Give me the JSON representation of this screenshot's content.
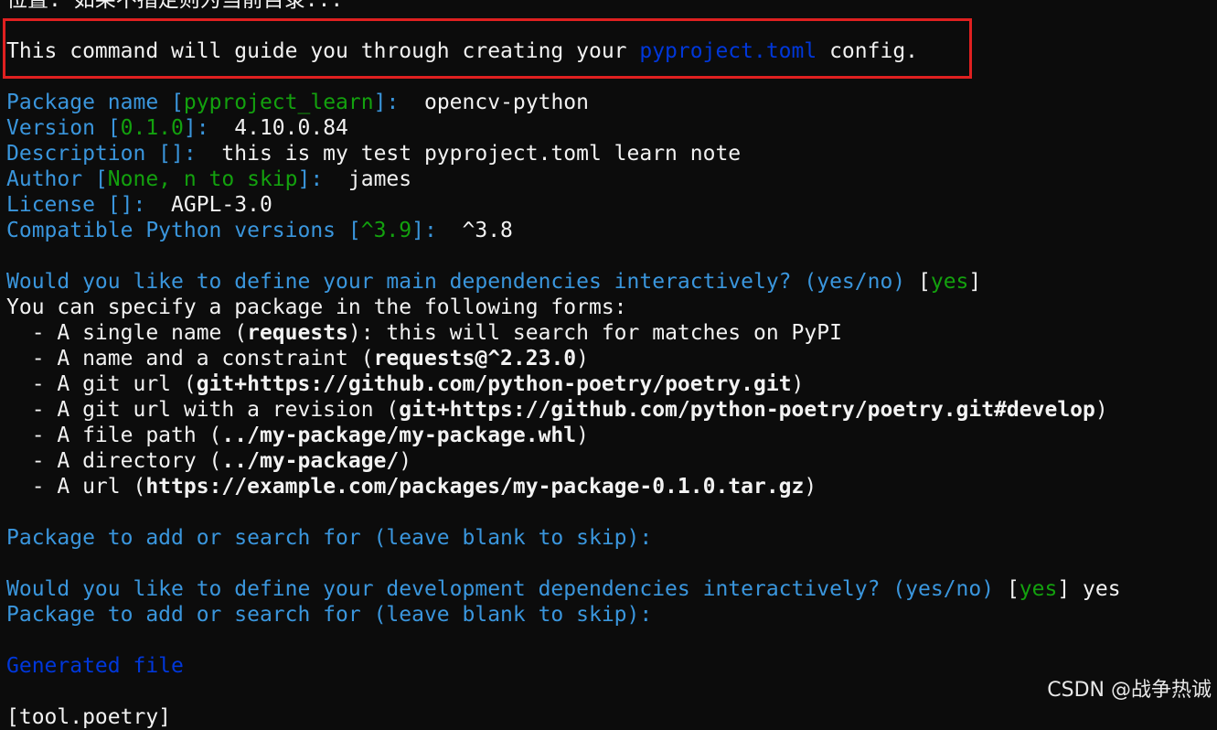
{
  "terminal": {
    "lines": [
      {
        "segments": [
          {
            "text": "位置: 如果不指定则为当前目录...",
            "cls": "white"
          }
        ]
      },
      {
        "segments": [
          {
            "text": ""
          }
        ]
      },
      {
        "segments": [
          {
            "text": "This command will guide you through creating your ",
            "cls": "white"
          },
          {
            "text": "pyproject.toml",
            "cls": "dblue"
          },
          {
            "text": " config.",
            "cls": "white"
          }
        ]
      },
      {
        "segments": [
          {
            "text": ""
          }
        ]
      },
      {
        "segments": [
          {
            "text": "Package name [",
            "cls": "blue"
          },
          {
            "text": "pyproject_learn",
            "cls": "green"
          },
          {
            "text": "]:  ",
            "cls": "blue"
          },
          {
            "text": "opencv-python",
            "cls": "white"
          }
        ]
      },
      {
        "segments": [
          {
            "text": "Version [",
            "cls": "blue"
          },
          {
            "text": "0.1.0",
            "cls": "green"
          },
          {
            "text": "]:  ",
            "cls": "blue"
          },
          {
            "text": "4.10.0.84",
            "cls": "white"
          }
        ]
      },
      {
        "segments": [
          {
            "text": "Description []:  ",
            "cls": "blue"
          },
          {
            "text": "this is my test pyproject.toml learn note",
            "cls": "white"
          }
        ]
      },
      {
        "segments": [
          {
            "text": "Author [",
            "cls": "blue"
          },
          {
            "text": "None, n to skip",
            "cls": "green"
          },
          {
            "text": "]:  ",
            "cls": "blue"
          },
          {
            "text": "james",
            "cls": "white"
          }
        ]
      },
      {
        "segments": [
          {
            "text": "License []:  ",
            "cls": "blue"
          },
          {
            "text": "AGPL-3.0",
            "cls": "white"
          }
        ]
      },
      {
        "segments": [
          {
            "text": "Compatible Python versions [",
            "cls": "blue"
          },
          {
            "text": "^3.9",
            "cls": "green"
          },
          {
            "text": "]:  ",
            "cls": "blue"
          },
          {
            "text": "^3.8",
            "cls": "white"
          }
        ]
      },
      {
        "segments": [
          {
            "text": ""
          }
        ]
      },
      {
        "segments": [
          {
            "text": "Would you like to define your main dependencies interactively? (yes/no) ",
            "cls": "blue"
          },
          {
            "text": "[",
            "cls": "white"
          },
          {
            "text": "yes",
            "cls": "green"
          },
          {
            "text": "]",
            "cls": "white"
          }
        ]
      },
      {
        "segments": [
          {
            "text": "You can specify a package in the following forms:",
            "cls": "white"
          }
        ]
      },
      {
        "segments": [
          {
            "text": "  - A single name (",
            "cls": "white"
          },
          {
            "text": "requests",
            "cls": "white bold"
          },
          {
            "text": "): this will search for matches on PyPI",
            "cls": "white"
          }
        ]
      },
      {
        "segments": [
          {
            "text": "  - A name and a constraint (",
            "cls": "white"
          },
          {
            "text": "requests@^2.23.0",
            "cls": "white bold"
          },
          {
            "text": ")",
            "cls": "white"
          }
        ]
      },
      {
        "segments": [
          {
            "text": "  - A git url (",
            "cls": "white"
          },
          {
            "text": "git+https://github.com/python-poetry/poetry.git",
            "cls": "white bold"
          },
          {
            "text": ")",
            "cls": "white"
          }
        ]
      },
      {
        "segments": [
          {
            "text": "  - A git url with a revision (",
            "cls": "white"
          },
          {
            "text": "git+https://github.com/python-poetry/poetry.git#develop",
            "cls": "white bold"
          },
          {
            "text": ")",
            "cls": "white"
          }
        ]
      },
      {
        "segments": [
          {
            "text": "  - A file path (",
            "cls": "white"
          },
          {
            "text": "../my-package/my-package.whl",
            "cls": "white bold"
          },
          {
            "text": ")",
            "cls": "white"
          }
        ]
      },
      {
        "segments": [
          {
            "text": "  - A directory (",
            "cls": "white"
          },
          {
            "text": "../my-package/",
            "cls": "white bold"
          },
          {
            "text": ")",
            "cls": "white"
          }
        ]
      },
      {
        "segments": [
          {
            "text": "  - A url (",
            "cls": "white"
          },
          {
            "text": "https://example.com/packages/my-package-0.1.0.tar.gz",
            "cls": "white bold"
          },
          {
            "text": ")",
            "cls": "white"
          }
        ]
      },
      {
        "segments": [
          {
            "text": ""
          }
        ]
      },
      {
        "segments": [
          {
            "text": "Package to add or search for (leave blank to skip):",
            "cls": "blue"
          }
        ]
      },
      {
        "segments": [
          {
            "text": ""
          }
        ]
      },
      {
        "segments": [
          {
            "text": "Would you like to define your development dependencies interactively? (yes/no) ",
            "cls": "blue"
          },
          {
            "text": "[",
            "cls": "white"
          },
          {
            "text": "yes",
            "cls": "green"
          },
          {
            "text": "] ",
            "cls": "white"
          },
          {
            "text": "yes",
            "cls": "white"
          }
        ]
      },
      {
        "segments": [
          {
            "text": "Package to add or search for (leave blank to skip):",
            "cls": "blue"
          }
        ]
      },
      {
        "segments": [
          {
            "text": ""
          }
        ]
      },
      {
        "segments": [
          {
            "text": "Generated file",
            "cls": "dblue"
          }
        ]
      },
      {
        "segments": [
          {
            "text": ""
          }
        ]
      },
      {
        "segments": [
          {
            "text": "[tool.poetry]",
            "cls": "white"
          }
        ]
      }
    ]
  },
  "watermark": "CSDN @战争热诚",
  "colors": {
    "background": "#0c0c0c",
    "prompt_blue": "#3a96dd",
    "default_green": "#13a10e",
    "dark_blue": "#0037da",
    "text_white": "#f2f2f2",
    "highlight_red": "#e02020"
  }
}
